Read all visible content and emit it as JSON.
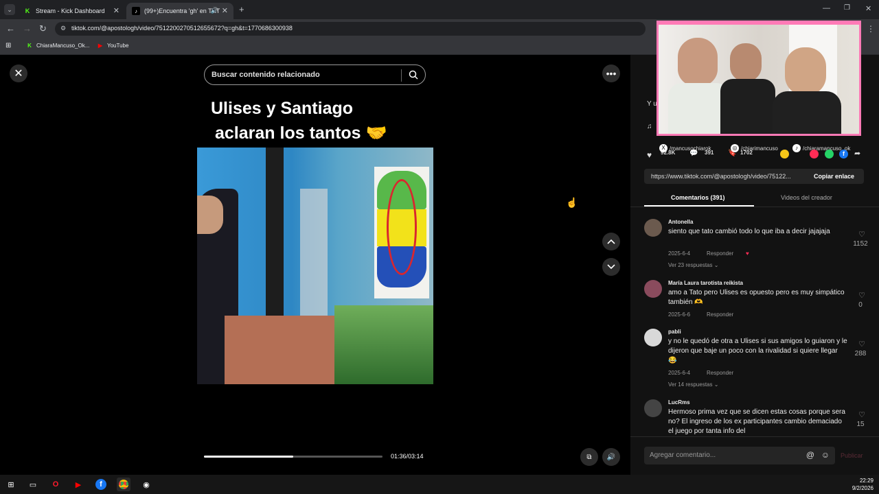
{
  "browser": {
    "tabs": [
      {
        "label": "Stream - Kick Dashboard",
        "favicon": "K"
      },
      {
        "label": "(99+)Encuentra 'gh' en TikT",
        "favicon": "tiktok"
      }
    ],
    "new_tab": "+",
    "url": "tiktok.com/@apostologh/video/7512200270512655672?q=gh&t=1770686300938",
    "bookmarks": [
      {
        "label": "ChiaraMancuso_Ok...",
        "favicon": "K"
      },
      {
        "label": "YouTube",
        "favicon": "▶"
      }
    ]
  },
  "tiktok": {
    "search_placeholder": "Buscar contenido relacionado",
    "caption_line1": "Ulises y Santiago",
    "caption_line2": "aclaran los tantos 🤝",
    "progress_fraction": 0.5,
    "time": "01:36/03:14",
    "stats": {
      "likes": "92.8K",
      "comments": "391",
      "saves": "1702"
    },
    "socials": [
      "/mancusochiarok",
      "/chiarimancuso",
      "/chiaramancuso_ok"
    ],
    "link": "https://www.tiktok.com/@apostologh/video/75122...",
    "copy_link": "Copiar enlace",
    "tabs": [
      "Comentarios (391)",
      "Videos del creador"
    ],
    "comments": [
      {
        "user": "Antonella",
        "text": "siento que tato cambió todo lo que iba a decir jajajaja",
        "date": "2025-6-4",
        "reply": "Responder",
        "more": "Ver 23 respuestas",
        "likes": "1152"
      },
      {
        "user": "María Laura tarotista reikista",
        "text": "amo a Tato pero Ulises es opuesto pero es muy simpático también 🫶",
        "date": "2025-6-6",
        "reply": "Responder",
        "more": "",
        "likes": "0"
      },
      {
        "user": "pabli",
        "text": "y no le quedó de otra a Ulises si sus amigos lo guiaron y le dijeron que baje un poco con la rivalidad si quiere llegar 😂",
        "date": "2025-6-4",
        "reply": "Responder",
        "more": "Ver 14 respuestas",
        "likes": "288"
      },
      {
        "user": "LucRms",
        "text": "Hermoso prima vez que se dicen estas cosas porque sera no? El ingreso de los ex participantes cambio demaciado el juego por tanta info del",
        "date": "",
        "reply": "",
        "more": "",
        "likes": "15"
      }
    ],
    "add_comment": "Agregar comentario...",
    "publish": "Publicar"
  },
  "taskbar": {
    "time": "22:29",
    "date": "9/2/2026"
  },
  "colors": {
    "accent_pink": "#ff7ab6",
    "kick_green": "#53fc18",
    "tiktok_red": "#fe2c55"
  }
}
